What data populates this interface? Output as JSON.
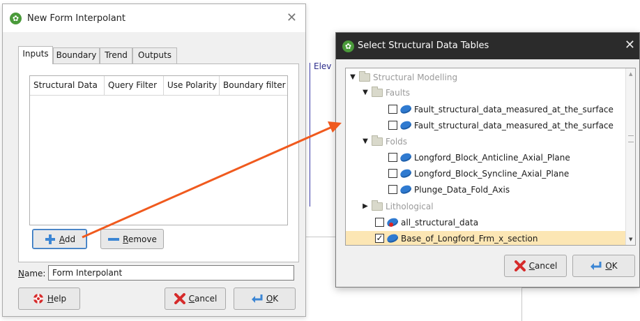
{
  "background": {
    "axis_label": "Elev"
  },
  "form_dialog": {
    "title": "New Form Interpolant",
    "tabs": [
      "Inputs",
      "Boundary",
      "Trend",
      "Outputs"
    ],
    "table": {
      "columns": [
        "Structural Data",
        "Query Filter",
        "Use Polarity",
        "Boundary filter"
      ]
    },
    "add_button": {
      "mnemonic": "A",
      "rest": "dd"
    },
    "remove_button": {
      "mnemonic": "R",
      "rest": "emove"
    },
    "name_label": {
      "mnemonic": "N",
      "rest": "ame:"
    },
    "name_value": "Form Interpolant",
    "help_button": {
      "mnemonic": "H",
      "rest": "elp"
    },
    "cancel_button": {
      "mnemonic": "C",
      "rest": "ancel"
    },
    "ok_button": {
      "mnemonic": "O",
      "rest": "K"
    }
  },
  "select_dialog": {
    "title": "Select Structural Data Tables",
    "tree": {
      "root": "Structural Modelling",
      "faults": "Faults",
      "faults_items": [
        {
          "label": "Fault_structural_data_measured_at_the_surface",
          "checked": false
        },
        {
          "label": "Fault_structural_data_measured_at_the_surface",
          "checked": false
        }
      ],
      "folds": "Folds",
      "folds_items": [
        {
          "label": "Longford_Block_Anticline_Axial_Plane",
          "checked": false
        },
        {
          "label": "Longford_Block_Syncline_Axial_Plane",
          "checked": false
        },
        {
          "label": "Plunge_Data_Fold_Axis",
          "checked": false
        }
      ],
      "lithological": "Lithological",
      "all_structural": "all_structural_data",
      "selected_item": "Base_of_Longford_Frm_x_section"
    },
    "cancel_button": {
      "mnemonic": "C",
      "rest": "ancel"
    },
    "ok_button": {
      "mnemonic": "O",
      "rest": "K"
    }
  },
  "colors": {
    "accent": "#2f6fb5",
    "selection": "#fce6b4",
    "arrow": "#f05a1e"
  }
}
